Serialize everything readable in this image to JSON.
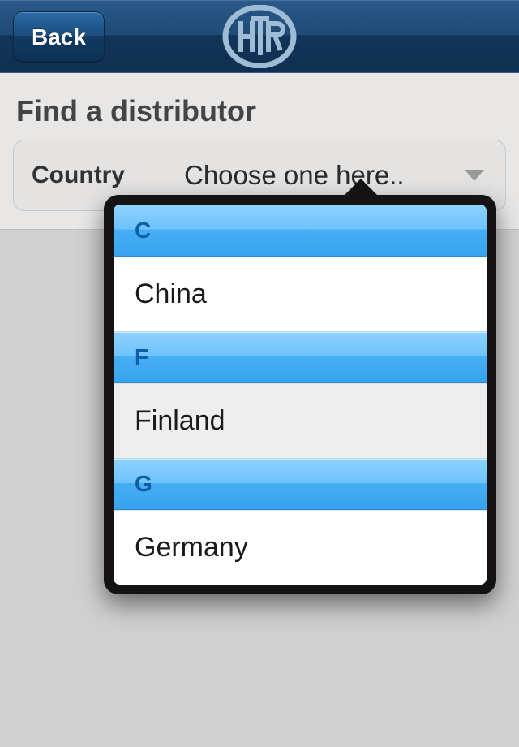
{
  "nav": {
    "back_label": "Back",
    "logo_name": "htr-logo"
  },
  "page": {
    "title": "Find a distributor"
  },
  "form": {
    "country_label": "Country",
    "country_placeholder": "Choose one here.."
  },
  "dropdown": {
    "sections": [
      {
        "letter": "C",
        "items": [
          "China"
        ]
      },
      {
        "letter": "F",
        "items": [
          "Finland"
        ]
      },
      {
        "letter": "G",
        "items": [
          "Germany"
        ]
      }
    ]
  },
  "colors": {
    "navbar_top": "#2a5a8a",
    "navbar_bottom": "#0f2f50",
    "section_header_top": "#8fd2ff",
    "section_header_bottom": "#37a3ef",
    "section_header_text": "#0d5ea4",
    "body_bg": "#d0d0d0"
  }
}
